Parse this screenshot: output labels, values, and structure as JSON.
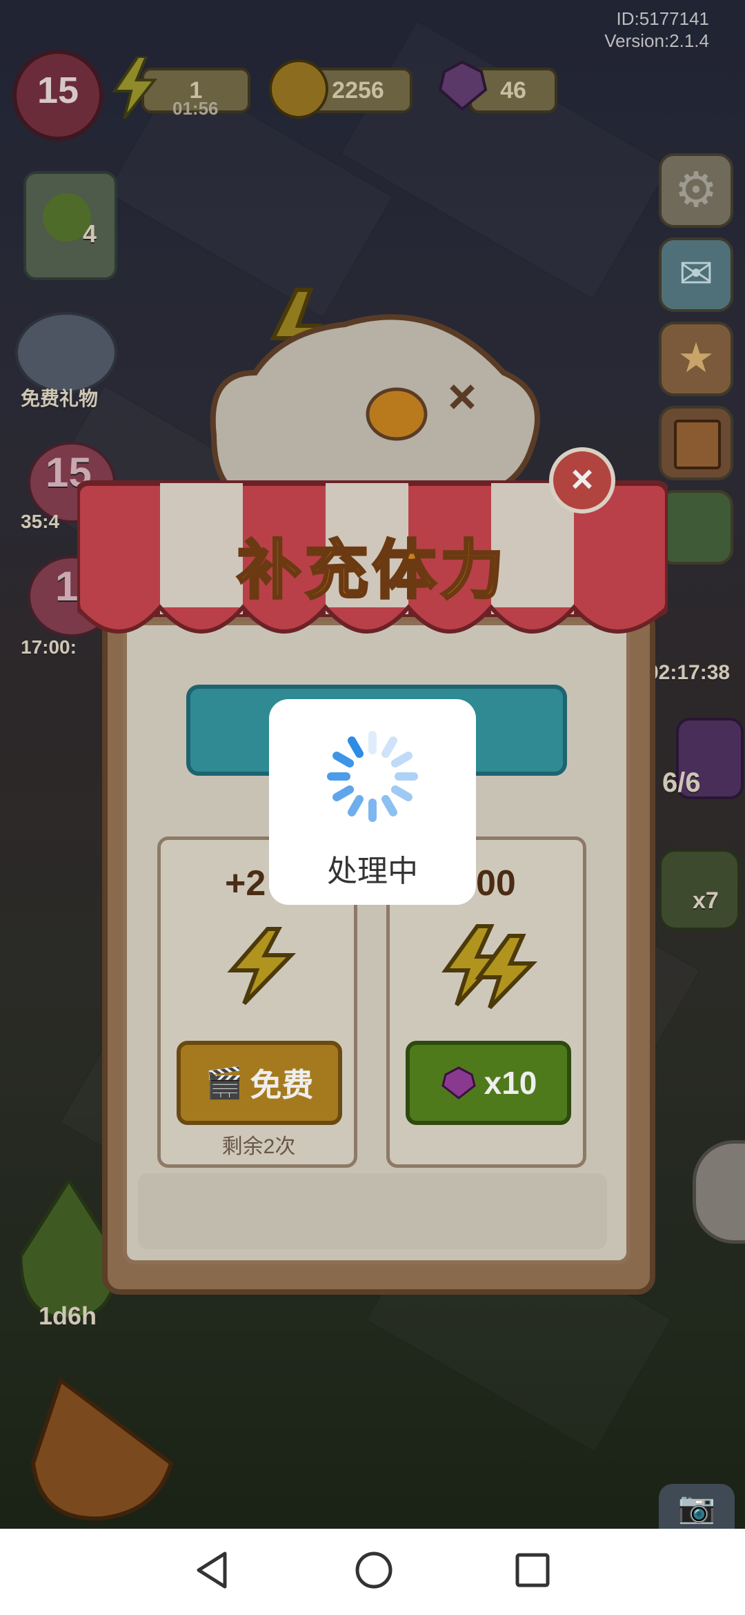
{
  "hud": {
    "level": "15",
    "energy_value": "1",
    "energy_timer": "01:56",
    "coins": "2256",
    "gems": "46",
    "user_id": "ID:5177141",
    "version": "Version:2.1.4"
  },
  "left_side": {
    "quest_badge": "4",
    "free_gift_label": "免费礼物",
    "event1_level": "15",
    "event1_timer": "35:4",
    "event2_level": "1",
    "event2_timer": "17:00:",
    "bottom_timer": "1d6h"
  },
  "right_side": {
    "sale_timer": "02:17:38",
    "stock": "6/6",
    "clover_count": "x7"
  },
  "popup": {
    "title": "补充体力",
    "close_label": "×",
    "free_card": {
      "amount": "+2",
      "button_label": "免费",
      "remaining": "剩余2次"
    },
    "gem_card": {
      "amount": "00",
      "button_label": "x10"
    }
  },
  "loading": {
    "text": "处理中"
  },
  "colors": {
    "spinner": "#2e8be6",
    "awning_red": "#b94048",
    "free_button": "#c08a1c",
    "gem_button": "#4f7a1c"
  }
}
